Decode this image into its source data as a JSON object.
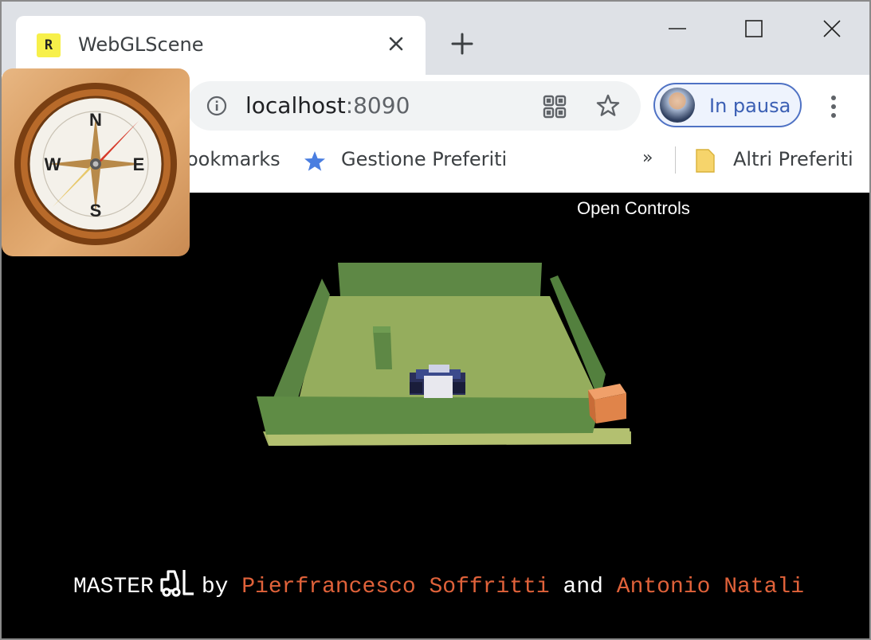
{
  "tab": {
    "favicon_letter": "R",
    "title": "WebGLScene"
  },
  "window_controls": {
    "minimize": "minimize-icon",
    "maximize": "maximize-icon",
    "close": "close-icon"
  },
  "address_bar": {
    "host": "localhost",
    "port": ":8090"
  },
  "profile": {
    "label": "In pausa"
  },
  "bookmarks_bar": {
    "items": [
      {
        "label": "ookmarks"
      },
      {
        "label": "Gestione Preferiti"
      }
    ],
    "overflow": "»",
    "other": "Altri Preferiti"
  },
  "scene": {
    "open_controls": "Open Controls",
    "credit": {
      "master": "MASTER",
      "by": "by",
      "author1": "Pierfrancesco Soffritti",
      "and": "and",
      "author2": "Antonio Natali"
    }
  },
  "compass_icon": {
    "n": "N",
    "s": "S",
    "e": "E",
    "w": "W"
  },
  "colors": {
    "floor": "#8fa85a",
    "walls": "#5f8a45",
    "box": "#e0844a",
    "credit_name": "#e0623a"
  }
}
